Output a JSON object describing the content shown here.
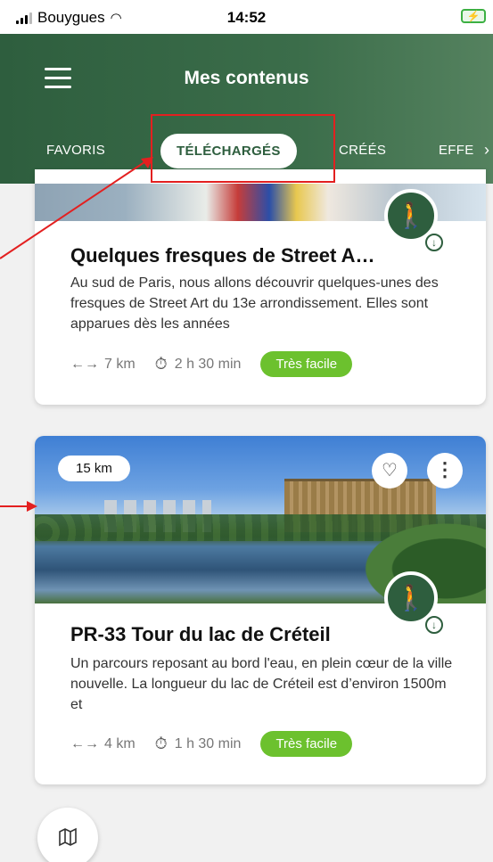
{
  "status_bar": {
    "carrier": "Bouygues",
    "time": "14:52",
    "battery_icon": "battery-charging-icon"
  },
  "header": {
    "title": "Mes contenus"
  },
  "tabs": [
    {
      "label": "FAVORIS"
    },
    {
      "label": "TÉLÉCHARGÉS"
    },
    {
      "label": "CRÉÉS"
    },
    {
      "label": "EFFE"
    }
  ],
  "tab_more": "›",
  "cards": [
    {
      "title": "Quelques fresques de Street A…",
      "description": "Au sud de Paris, nous allons découvrir quelques-unes des fresques de Street Art du 13e arrondissement. Elles sont apparues dès les années",
      "distance": "7 km",
      "duration": "2 h 30 min",
      "difficulty": "Très facile"
    },
    {
      "distance_badge": "15 km",
      "title": "PR-33 Tour du lac de Créteil",
      "description": "Un parcours reposant au bord l'eau, en plein cœur de la ville nouvelle. La longueur du lac de Créteil est d’environ 1500m et",
      "distance": "4 km",
      "duration": "1 h 30 min",
      "difficulty": "Très facile"
    }
  ],
  "icons": {
    "menu": "☰",
    "walk": "🚶",
    "download": "↓",
    "distance": "←→",
    "timer": "⏱",
    "heart": "♡",
    "more": "⋮",
    "map": "🗺"
  },
  "colors": {
    "primary": "#2e5e3e",
    "difficulty": "#6cc12e",
    "highlight": "#e32020"
  }
}
